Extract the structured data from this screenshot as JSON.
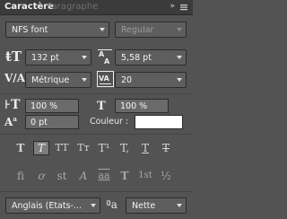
{
  "panel": {
    "title": "Caractère",
    "ghost_tab": "Paragraphe"
  },
  "font": {
    "family": "NFS font",
    "style": "Regular"
  },
  "size": {
    "value": "132 pt"
  },
  "leading": {
    "value": "5,58 pt"
  },
  "kerning": {
    "value": "Métrique"
  },
  "tracking": {
    "value": "20"
  },
  "vscale": {
    "value": "100 %"
  },
  "hscale": {
    "value": "100 %"
  },
  "baseline": {
    "value": "0 pt"
  },
  "color": {
    "label": "Couleur :",
    "swatch": "#ffffff"
  },
  "typestyle": {
    "buttons": [
      "T",
      "T",
      "TT",
      "Tт",
      "T¹",
      "T,",
      "T",
      "T"
    ],
    "active_index": 1
  },
  "opentype": {
    "buttons": [
      "fi",
      "ơ",
      "st",
      "A",
      "aa",
      "T",
      "1st",
      "½"
    ]
  },
  "language": {
    "value": "Anglais (Etats-..."
  },
  "aa_icon": "ªa",
  "antialias": {
    "value": "Nette"
  }
}
